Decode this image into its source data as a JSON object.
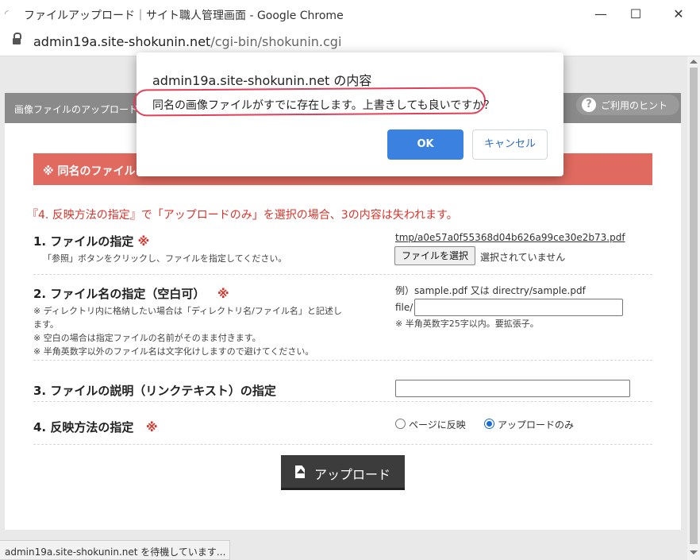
{
  "window": {
    "title": "ファイルアップロード｜サイト職人管理画面 - Google Chrome",
    "minimize": "—",
    "maximize": "☐",
    "close": "✕"
  },
  "address": {
    "host": "admin19a.site-shokunin.net",
    "path": "/cgi-bin/shokunin.cgi"
  },
  "header": {
    "tab_label": "画像ファイルのアップロード",
    "hint_label": "ご利用のヒント"
  },
  "warning_bar": "※ 同名のファイル",
  "notice": "『4. 反映方法の指定』で「アップロードのみ」を選択の場合、3の内容は失われます。",
  "rows": {
    "file": {
      "title": "1. ファイルの指定",
      "required_mark": "※",
      "desc": "「参照」ボタンをクリックし、ファイルを指定してください。",
      "current_file": "tmp/a0e57a0f55368d04b626a99ce30e2b73.pdf",
      "choose_button": "ファイルを選択",
      "no_file_text": "選択されていません"
    },
    "filename": {
      "title": "2. ファイル名の指定（空白可）",
      "required_mark": "※",
      "desc1": "※ ディレクトリ内に格納したい場合は「ディレクトリ名/ファイル名」と記述し",
      "desc2": "ます。",
      "desc3": "※ 空白の場合は指定ファイルの名前がそのまま付きます。",
      "desc4": "※ 半角英数字以外のファイル名は文字化けしますので避けてください。",
      "example": "例）sample.pdf 又は directry/sample.pdf",
      "prefix": "file/",
      "value": "",
      "rule": "※ 半角英数字25字以内。要拡張子。"
    },
    "description": {
      "title": "3. ファイルの説明（リンクテキスト）の指定",
      "value": ""
    },
    "method": {
      "title": "4. 反映方法の指定",
      "required_mark": "※",
      "option_page": "ページに反映",
      "option_upload": "アップロードのみ",
      "selected": "アップロードのみ"
    }
  },
  "upload_button": "アップロード",
  "status": "admin19a.site-shokunin.net を待機しています...",
  "dialog": {
    "title": "admin19a.site-shokunin.net の内容",
    "message": "同名の画像ファイルがすでに存在します。上書きしても良いですか？",
    "ok": "OK",
    "cancel": "キャンセル"
  }
}
